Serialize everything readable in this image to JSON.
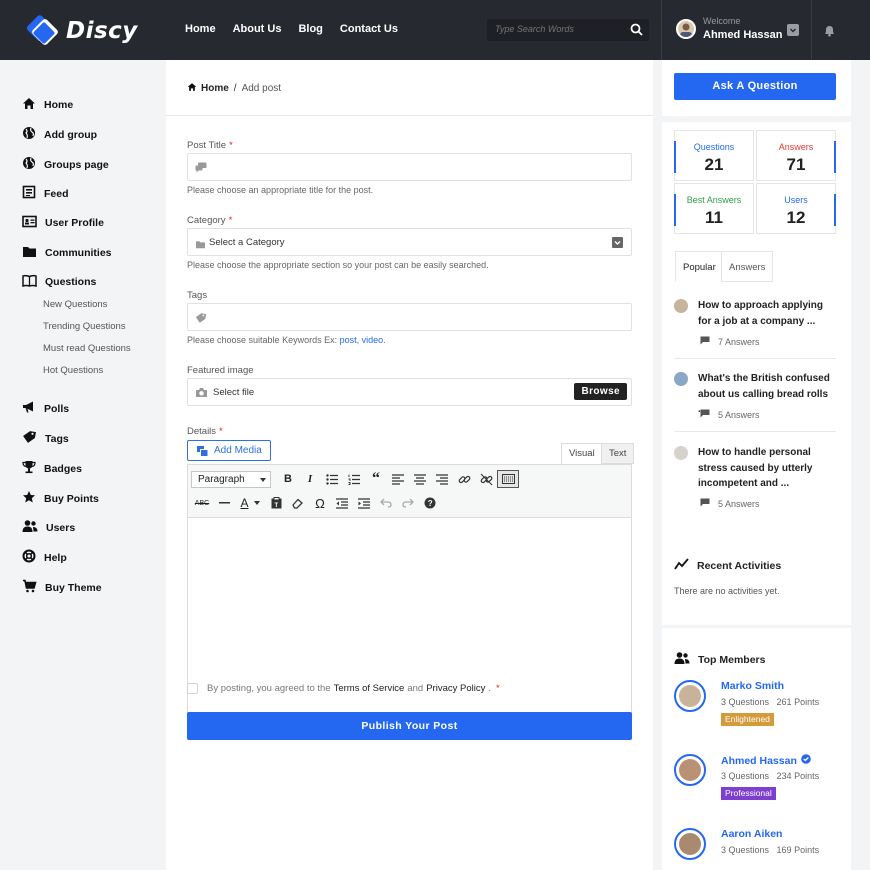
{
  "header": {
    "logo_text": "Discy",
    "nav": [
      "Home",
      "About Us",
      "Blog",
      "Contact Us"
    ],
    "search_placeholder": "Type Search Words",
    "welcome": "Welcome",
    "user_name": "Ahmed Hassan"
  },
  "sidebar": {
    "items": [
      {
        "label": "Home",
        "icon": "home-icon"
      },
      {
        "label": "Add group",
        "icon": "globe-icon"
      },
      {
        "label": "Groups page",
        "icon": "globe-icon"
      },
      {
        "label": "Feed",
        "icon": "feed-icon"
      },
      {
        "label": "User Profile",
        "icon": "id-card-icon"
      },
      {
        "label": "Communities",
        "icon": "folder-icon"
      },
      {
        "label": "Questions",
        "icon": "book-icon"
      }
    ],
    "sub_items": [
      "New Questions",
      "Trending Questions",
      "Must read Questions",
      "Hot Questions"
    ],
    "items2": [
      {
        "label": "Polls",
        "icon": "megaphone-icon"
      },
      {
        "label": "Tags",
        "icon": "tag-icon"
      },
      {
        "label": "Badges",
        "icon": "trophy-icon"
      },
      {
        "label": "Buy Points",
        "icon": "star-icon"
      },
      {
        "label": "Users",
        "icon": "users-icon"
      },
      {
        "label": "Help",
        "icon": "lifebuoy-icon"
      },
      {
        "label": "Buy Theme",
        "icon": "cart-icon"
      }
    ]
  },
  "main": {
    "breadcrumb_home": "Home",
    "breadcrumb_sep": "/",
    "breadcrumb_current": "Add post",
    "post_title_label": "Post Title",
    "post_title_hint": "Please choose an appropriate title for the post.",
    "category_label": "Category",
    "category_value": "Select a Category",
    "category_hint": "Please choose the appropriate section so your post can be easily searched.",
    "tags_label": "Tags",
    "tags_hint_prefix": "Please choose suitable Keywords Ex:",
    "tags_hint_ex1": "post",
    "tags_hint_comma": ",",
    "tags_hint_ex2": "video",
    "tags_hint_period": ".",
    "featured_label": "Featured image",
    "select_file": "Select file",
    "browse": "Browse",
    "details_label": "Details",
    "required_mark": "*",
    "add_media": "Add Media",
    "tab_visual": "Visual",
    "tab_text": "Text",
    "paragraph": "Paragraph",
    "agree_prefix": "By posting, you agreed to the",
    "terms": "Terms of Service",
    "agree_and": "and",
    "privacy": "Privacy Policy",
    "agree_period": ".",
    "publish": "Publish Your Post"
  },
  "right": {
    "ask_button": "Ask A Question",
    "stats": [
      {
        "label": "Questions",
        "value": "21",
        "color": "#2468f2"
      },
      {
        "label": "Answers",
        "value": "71",
        "color": "#e53935"
      },
      {
        "label": "Best Answers",
        "value": "11",
        "color": "#2e9d4a"
      },
      {
        "label": "Users",
        "value": "12",
        "color": "#2468f2"
      }
    ],
    "tabs": [
      "Popular",
      "Answers"
    ],
    "popular": [
      {
        "title": "How to approach applying for a job at a company ...",
        "answers": "7 Answers"
      },
      {
        "title": "What's the British confused about us calling bread rolls ...",
        "answers": "5 Answers"
      },
      {
        "title": "How to handle personal stress caused by utterly incompetent and ...",
        "answers": "5 Answers"
      }
    ],
    "recent_title": "Recent Activities",
    "recent_empty": "There are no activities yet.",
    "top_members_title": "Top Members",
    "members": [
      {
        "name": "Marko Smith",
        "questions": "3 Questions",
        "points": "261 Points",
        "badge": "Enlightened",
        "badge_color": "#d59a3a",
        "verified": false
      },
      {
        "name": "Ahmed Hassan",
        "questions": "3 Questions",
        "points": "234 Points",
        "badge": "Professional",
        "badge_color": "#7c3fd0",
        "verified": true
      },
      {
        "name": "Aaron Aiken",
        "questions": "3 Questions",
        "points": "169 Points",
        "badge": "",
        "badge_color": "",
        "verified": false
      }
    ]
  }
}
